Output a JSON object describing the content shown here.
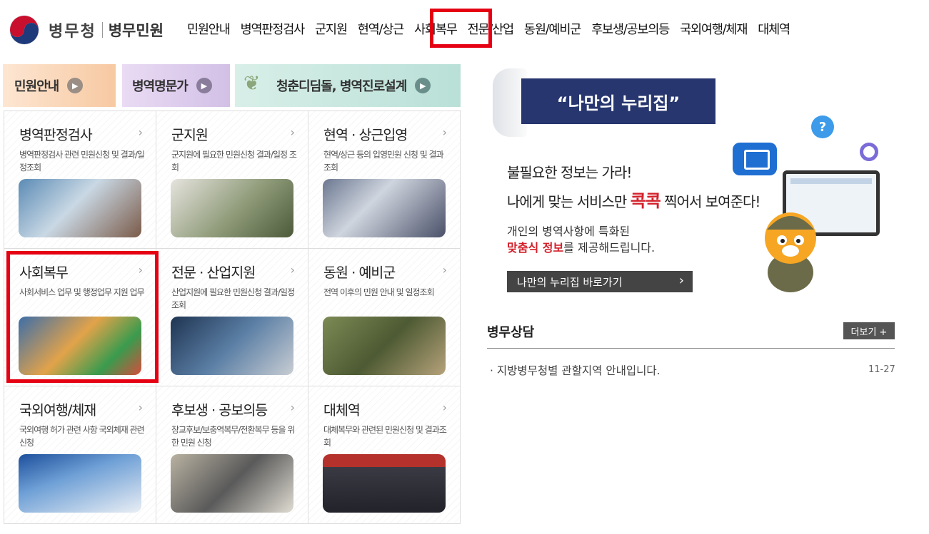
{
  "header": {
    "org_name": "병무청",
    "site_name": "병무민원",
    "nav": [
      "민원안내",
      "병역판정검사",
      "군지원",
      "현역/상근",
      "사회복무",
      "전문/산업",
      "동원/예비군",
      "후보생/공보의등",
      "국외여행/체재",
      "대체역"
    ],
    "highlighted": "사회복무"
  },
  "banners": {
    "b1": "민원안내",
    "b2": "병역명문가",
    "b3": "청춘디딤돌, 병역진로설계"
  },
  "grid": [
    {
      "title": "병역판정검사",
      "desc": "병역판정검사 관련 민원신청 및 결과/일정조회",
      "icon": "medical-exam-photo"
    },
    {
      "title": "군지원",
      "desc": "군지원에 필요한 민원신청 결과/일정 조회",
      "icon": "soldiers-computer-photo"
    },
    {
      "title": "현역 · 상근입영",
      "desc": "현역/상근 등의 입영민원 신청 및 결과 조회",
      "icon": "salute-photo"
    },
    {
      "title": "사회복무",
      "desc": "사회서비스 업무 및 행정업무 지원 업무",
      "icon": "social-service-photo"
    },
    {
      "title": "전문 · 산업지원",
      "desc": "산업지원에 필요한 민원신청 결과/일정 조회",
      "icon": "industry-worker-photo"
    },
    {
      "title": "동원 · 예비군",
      "desc": "전역 이후의 민원 안내 및 일정조회",
      "icon": "reserve-soldiers-photo"
    },
    {
      "title": "국외여행/체재",
      "desc": "국외여행 허가 관련 사항 국외체재 관련 신청",
      "icon": "airport-office-photo"
    },
    {
      "title": "후보생 · 공보의등",
      "desc": "장교후보/보충역복무/전환복무 등을 위한 민원 신청",
      "icon": "control-room-photo"
    },
    {
      "title": "대체역",
      "desc": "대체복무와 관련된 민원신청 및 결과조회",
      "icon": "ceremony-photo"
    }
  ],
  "promo": {
    "ribbon": "“나만의 누리집”",
    "line1": "불필요한 정보는 가라!",
    "line2_pre": "나에게 맞는 서비스만 ",
    "line2_accent": "콕콕",
    "line2_post": " 찍어서 보여준다!",
    "line3": "개인의 병역사항에 특화된",
    "line4_accent": "맞춤식 정보",
    "line4_post": "를 제공해드립니다.",
    "button": "나만의 누리집 바로가기"
  },
  "consult": {
    "title": "병무상담",
    "more": "더보기 +",
    "items": [
      {
        "text": "지방병무청별 관할지역 안내입니다.",
        "date": "11-27"
      }
    ]
  },
  "colors": {
    "highlight": "#e50012",
    "ribbon": "#27366e",
    "accent": "#d3202a"
  }
}
